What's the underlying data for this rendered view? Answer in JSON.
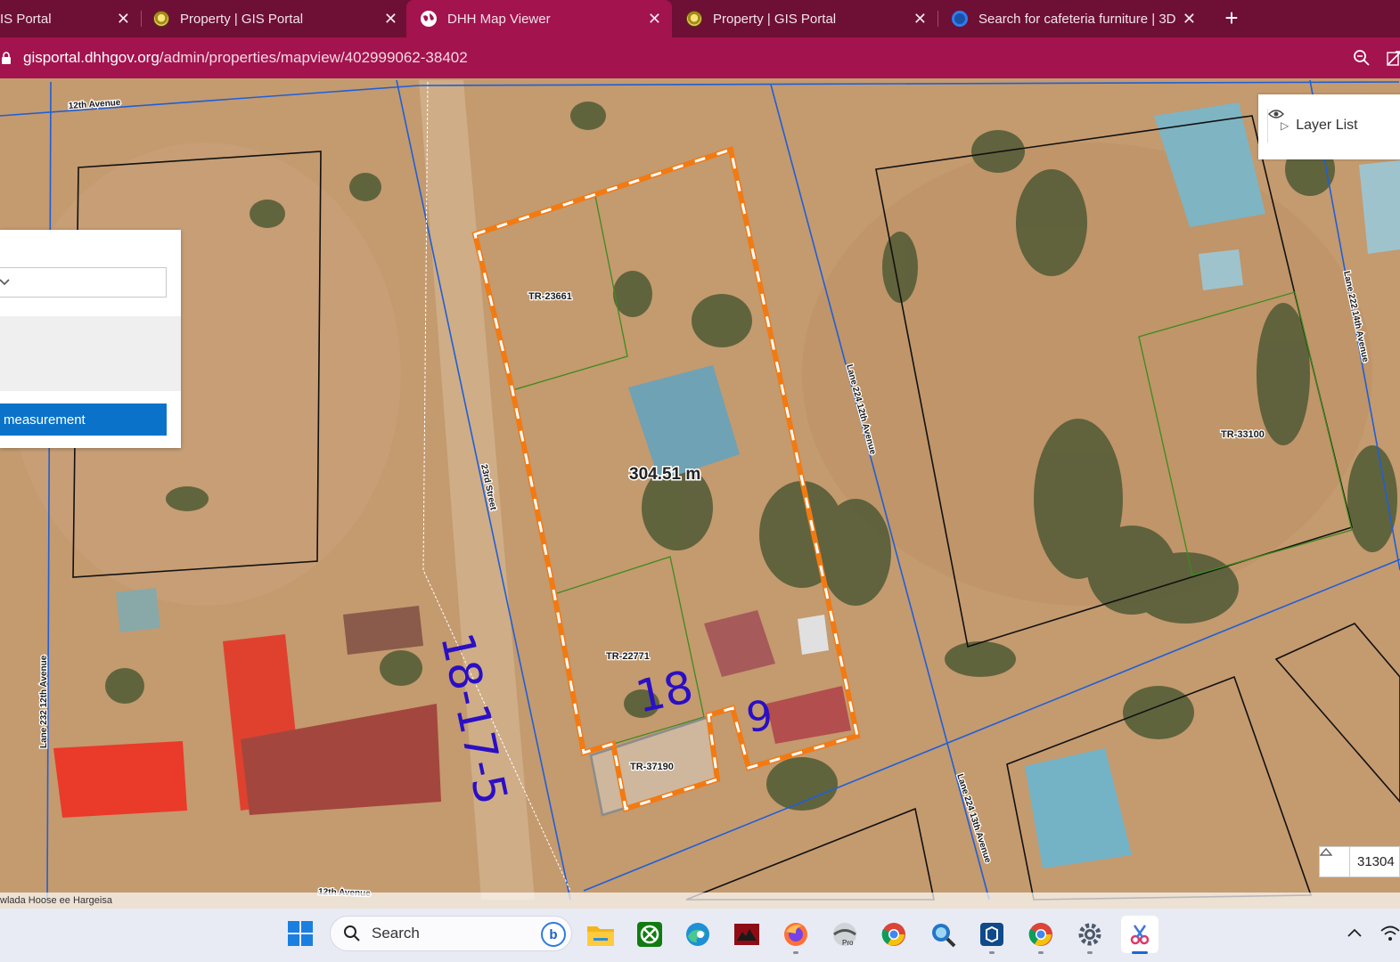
{
  "browser": {
    "tabs": [
      {
        "title": "IS Portal",
        "icon": "gis-portal-icon"
      },
      {
        "title": "Property | GIS Portal",
        "icon": "gis-portal-icon"
      },
      {
        "title": "DHH Map Viewer",
        "icon": "globe-icon",
        "active": true
      },
      {
        "title": "Property | GIS Portal",
        "icon": "gis-portal-icon"
      },
      {
        "title": "Search for cafeteria furniture | 3D",
        "icon": "3d-warehouse-icon"
      }
    ],
    "url_host": "gisportal.dhhgov.org",
    "url_path": "/admin/properties/mapview/402999062-38402"
  },
  "map": {
    "parcels": [
      "TR-23661",
      "TR-22771",
      "TR-37190",
      "TR-33100"
    ],
    "streets": {
      "twelfth_avenue_top": "12th Avenue",
      "twenty_third_street": "23rd Street",
      "lane_224_12th": "Lane 224 12th Avenue",
      "lane_222_14th": "Lane 222 14th Avenue",
      "lane_232_12th": "Lane 232 12th Avenue",
      "lane_224_13th": "Lane 224 13th Avenue",
      "twelfth_avenue_bottom": "12th Avenue"
    },
    "measurement_value": "304.51 m",
    "annotations": {
      "vertical_note": "18-17-5",
      "side_18": "18",
      "side_9": "9"
    }
  },
  "layer_list": {
    "label": "Layer List"
  },
  "measure_panel": {
    "button_label": "measurement"
  },
  "scale": {
    "value": "31304"
  },
  "attribution": "wlada Hoose ee Hargeisa",
  "taskbar": {
    "search_label": "Search",
    "apps": [
      "file-explorer",
      "xbox",
      "edge",
      "app-red",
      "firefox",
      "arcgis-pro",
      "chrome",
      "search-tool",
      "sketchup",
      "chrome",
      "settings",
      "snipping-tool"
    ]
  }
}
